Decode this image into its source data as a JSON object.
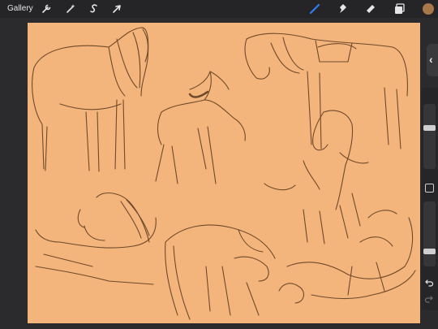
{
  "toolbar": {
    "gallery_label": "Gallery",
    "left_tools": [
      {
        "name": "actions",
        "icon": "wrench-icon"
      },
      {
        "name": "adjustments",
        "icon": "magic-wand-icon"
      },
      {
        "name": "selection",
        "icon": "selection-s-icon"
      },
      {
        "name": "transform",
        "icon": "arrow-cursor-icon"
      }
    ],
    "right_tools": [
      {
        "name": "brush",
        "icon": "brush-icon",
        "active": true
      },
      {
        "name": "smudge",
        "icon": "smudge-icon"
      },
      {
        "name": "eraser",
        "icon": "eraser-icon"
      },
      {
        "name": "layers",
        "icon": "layers-icon"
      }
    ],
    "current_color": "#a8784a",
    "active_tool_color": "#2f7df6"
  },
  "canvas": {
    "background_color": "#f4b57c",
    "sketch_color": "#6e4a2b"
  },
  "sidebar": {
    "collapse_glyph": "‹",
    "brush_size_level": 0.65,
    "opacity_level": 0.2,
    "undo_icon": "undo-icon",
    "redo_icon": "redo-icon"
  }
}
